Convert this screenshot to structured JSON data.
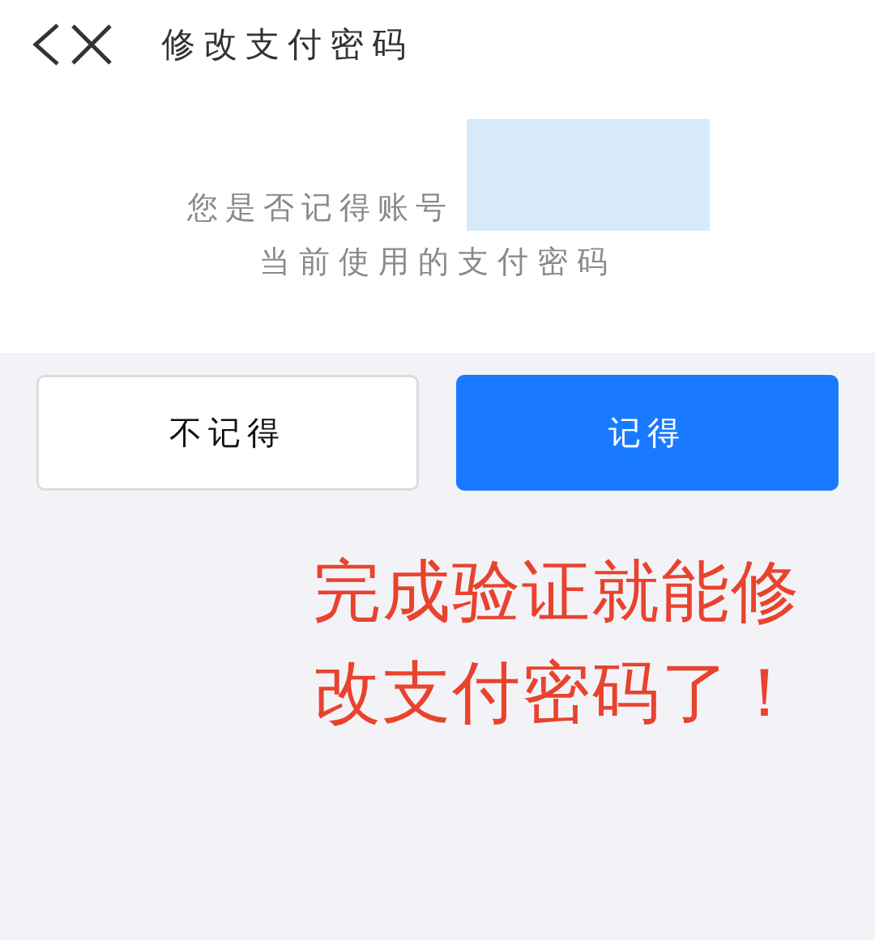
{
  "nav": {
    "title": "修改支付密码"
  },
  "prompt": {
    "line_1": "您是否记得账号",
    "line_2": "当前使用的支付密码"
  },
  "buttons": [
    {
      "label": "不记得",
      "kind": "secondary"
    },
    {
      "label": "记得",
      "kind": "primary"
    }
  ],
  "annotation": {
    "text": "完成验证就能修改支付密码了！"
  }
}
